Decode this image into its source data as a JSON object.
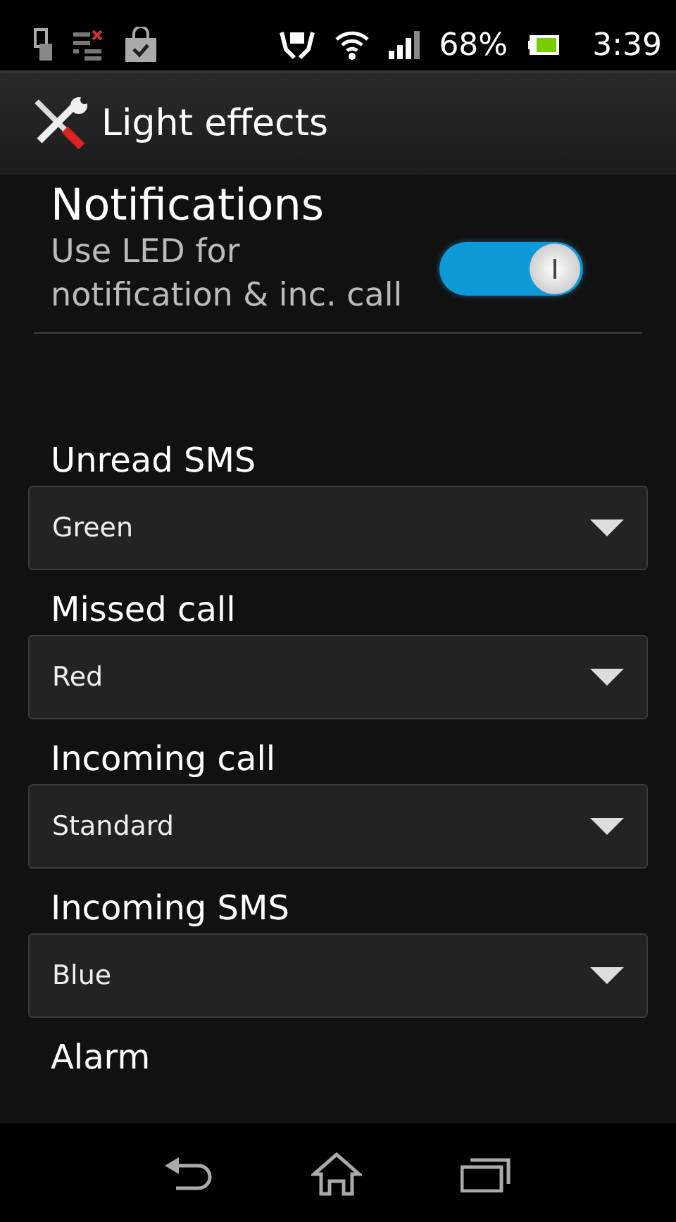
{
  "status_bar": {
    "battery": "68%",
    "time": "3:39"
  },
  "action_bar": {
    "title": "Light effects"
  },
  "section": {
    "title": "Notifications",
    "summary": "Use LED for notification & inc. call",
    "on": true
  },
  "settings": [
    {
      "label": "Unread SMS",
      "value": "Green"
    },
    {
      "label": "Missed call",
      "value": "Red"
    },
    {
      "label": "Incoming call",
      "value": "Standard"
    },
    {
      "label": "Incoming SMS",
      "value": "Blue"
    }
  ],
  "cut_label": "Alarm"
}
